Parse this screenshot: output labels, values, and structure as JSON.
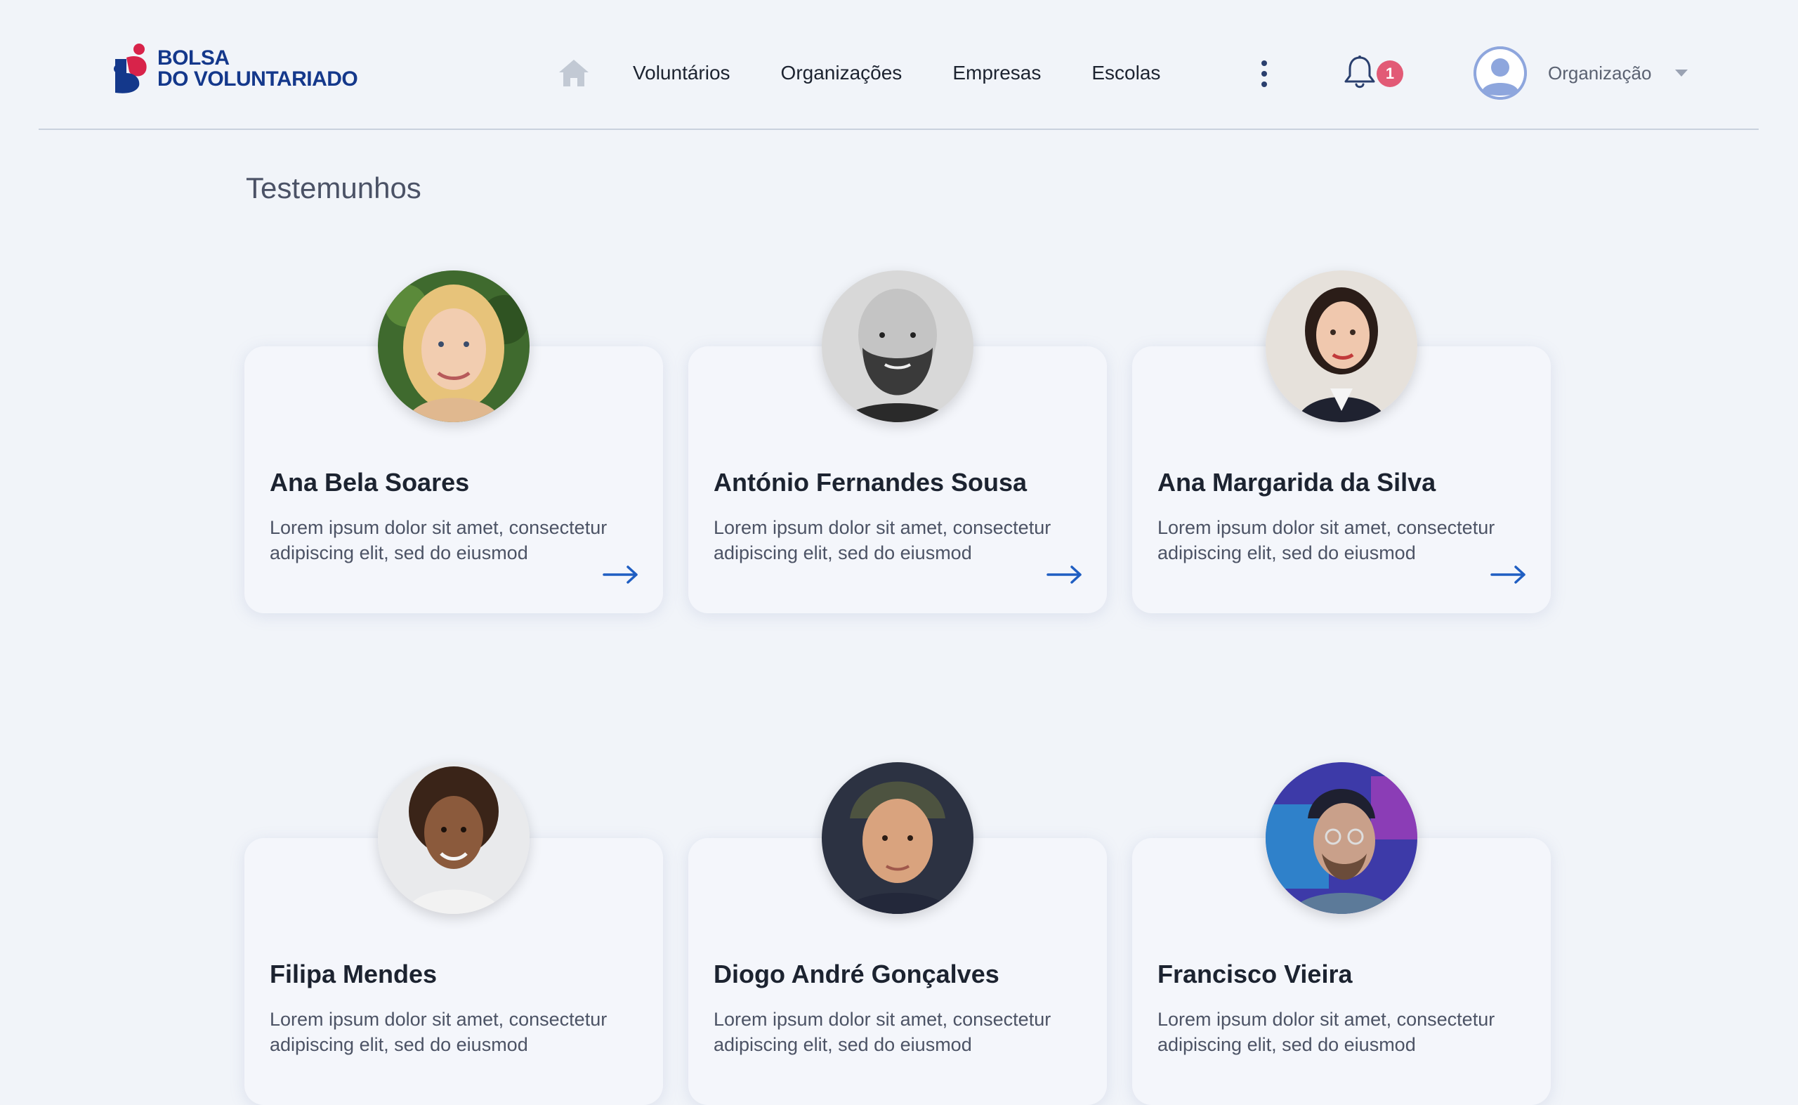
{
  "brand": {
    "line1": "BOLSA",
    "line2": "DO VOLUNTARIADO",
    "primary_color": "#14388b",
    "accent_color": "#d8234a"
  },
  "nav": {
    "home_icon": "home-icon",
    "items": [
      {
        "label": "Voluntários"
      },
      {
        "label": "Organizações"
      },
      {
        "label": "Empresas"
      },
      {
        "label": "Escolas"
      }
    ]
  },
  "header": {
    "notifications_count": "1",
    "user_label": "Organização"
  },
  "page": {
    "title": "Testemunhos"
  },
  "testimonials": [
    {
      "name": "Ana Bela Soares",
      "text": "Lorem ipsum dolor sit amet, consectetur adipiscing elit, sed do eiusmod"
    },
    {
      "name": "António Fernandes Sousa",
      "text": "Lorem ipsum dolor sit amet, consectetur adipiscing elit, sed do eiusmod"
    },
    {
      "name": "Ana Margarida da Silva",
      "text": "Lorem ipsum dolor sit amet, consectetur adipiscing elit, sed do eiusmod"
    },
    {
      "name": "Filipa Mendes",
      "text": "Lorem ipsum dolor sit amet, consectetur adipiscing elit, sed do eiusmod"
    },
    {
      "name": "Diogo André Gonçalves",
      "text": "Lorem ipsum dolor sit amet, consectetur adipiscing elit, sed do eiusmod"
    },
    {
      "name": "Francisco Vieira",
      "text": "Lorem ipsum dolor sit amet, consectetur adipiscing elit, sed do eiusmod"
    }
  ],
  "colors": {
    "background": "#f1f4f9",
    "arrow": "#1f5ec2",
    "badge": "#e25a76"
  }
}
